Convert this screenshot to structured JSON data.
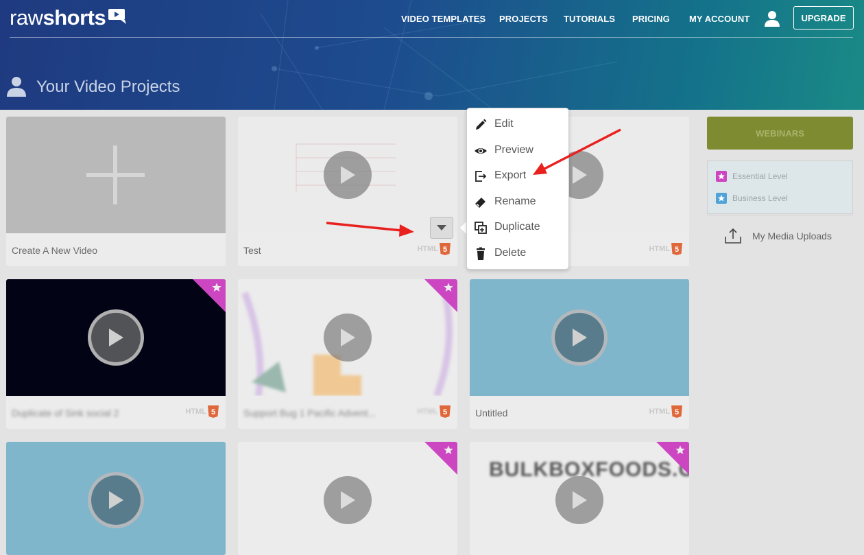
{
  "header": {
    "logo_light": "raw",
    "logo_bold": "shorts",
    "nav": [
      {
        "label": "VIDEO TEMPLATES"
      },
      {
        "label": "PROJECTS"
      },
      {
        "label": "TUTORIALS"
      },
      {
        "label": "PRICING"
      },
      {
        "label": "MY ACCOUNT"
      }
    ],
    "upgrade_label": "UPGRADE",
    "page_title": "Your Video Projects"
  },
  "cards": [
    {
      "label": "Create A New Video"
    },
    {
      "label": "Test",
      "format": "HTML"
    },
    {
      "label": "",
      "format": "HTML"
    },
    {
      "label": "Duplicate of Sink social 2",
      "format": "HTML"
    },
    {
      "label": "Support Bug 1 Pacific Advent...",
      "format": "HTML"
    },
    {
      "label": "Untitled",
      "format": "HTML"
    },
    {
      "label": ""
    },
    {
      "label": ""
    },
    {
      "label": "",
      "thumb_text": "BULKBOXFOODS.COM"
    }
  ],
  "menu": {
    "items": [
      {
        "label": "Edit",
        "icon": "pencil-icon"
      },
      {
        "label": "Preview",
        "icon": "eye-icon"
      },
      {
        "label": "Export",
        "icon": "export-icon"
      },
      {
        "label": "Rename",
        "icon": "eraser-icon"
      },
      {
        "label": "Duplicate",
        "icon": "duplicate-icon"
      },
      {
        "label": "Delete",
        "icon": "trash-icon"
      }
    ]
  },
  "sidebar": {
    "webinars_label": "WEBINARS",
    "levels": [
      {
        "label": "Essential Level",
        "color": "#cc46c1"
      },
      {
        "label": "Business Level",
        "color": "#4fa3d8"
      }
    ],
    "uploads_label": "My Media Uploads"
  },
  "colors": {
    "accent_magenta": "#cc46c1",
    "annotation_red": "#e8201e",
    "webinars_olive": "#7f8b31"
  }
}
